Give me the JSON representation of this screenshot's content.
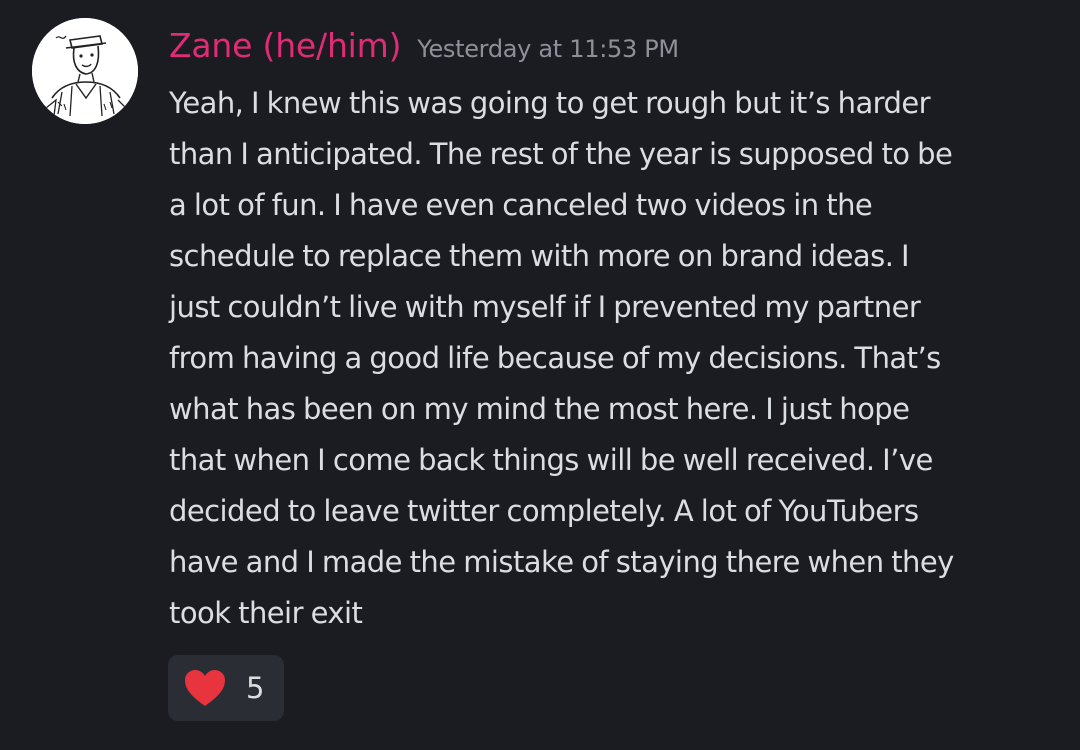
{
  "message": {
    "author": "Zane (he/him)",
    "timestamp": "Yesterday at 11:53 PM",
    "content_lines": [
      "Yeah, I knew this was going to get rough but it’s harder",
      "than I anticipated. The rest of the year is supposed to be",
      "a lot of fun. I have even canceled two videos in the",
      "schedule to replace them with more on brand ideas. I",
      "just couldn’t live with myself if I prevented my partner",
      "from having a good life because of my decisions. That’s",
      "what has been on my mind the most here. I just hope",
      "that when I come back things will be well received. I’ve",
      "decided to leave twitter completely. A lot of YouTubers",
      "have and I made the mistake of staying there when they",
      "took their exit"
    ],
    "reaction": {
      "emoji": "heart-icon",
      "count": "5"
    }
  },
  "colors": {
    "background": "#1b1c22",
    "author": "#e12b76",
    "timestamp": "#8e9099",
    "text": "#dbdee1",
    "reaction_bg": "#2b2d35",
    "heart": "#e8343f"
  }
}
